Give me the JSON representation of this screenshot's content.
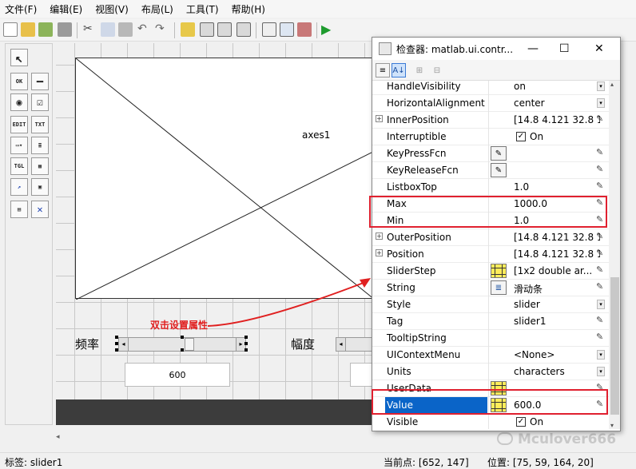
{
  "menu": [
    "文件(F)",
    "编辑(E)",
    "视图(V)",
    "布局(L)",
    "工具(T)",
    "帮助(H)"
  ],
  "canvas": {
    "axes_label": "axes1",
    "freq_label": "频率",
    "amp_label": "幅度",
    "edit_value": "600",
    "annotation": "双击设置属性"
  },
  "status": {
    "tag": "标签: slider1",
    "current_point": "当前点:  [652, 147]",
    "position": "位置: [75, 59, 164, 20]"
  },
  "inspector": {
    "title": "检查器:  matlab.ui.contr...",
    "rows": [
      {
        "name": "HandleVisibility",
        "value": "on",
        "kind": "dd"
      },
      {
        "name": "HorizontalAlignment",
        "value": "center",
        "kind": "dd"
      },
      {
        "name": "InnerPosition",
        "value": "[14.8 4.121 32.8 1....",
        "kind": "pen",
        "expand": true
      },
      {
        "name": "Interruptible",
        "value": "On",
        "kind": "check"
      },
      {
        "name": "KeyPressFcn",
        "value": "",
        "kind": "pen",
        "btn": "cb"
      },
      {
        "name": "KeyReleaseFcn",
        "value": "",
        "kind": "pen",
        "btn": "cb"
      },
      {
        "name": "ListboxTop",
        "value": "1.0",
        "kind": "pen"
      },
      {
        "name": "Max",
        "value": "1000.0",
        "kind": "pen"
      },
      {
        "name": "Min",
        "value": "1.0",
        "kind": "pen"
      },
      {
        "name": "OuterPosition",
        "value": "[14.8 4.121 32.8 1....",
        "kind": "pen",
        "expand": true
      },
      {
        "name": "Position",
        "value": "[14.8 4.121 32.8 1....",
        "kind": "pen",
        "expand": true
      },
      {
        "name": "SliderStep",
        "value": "[1x2  double ar...",
        "kind": "pen",
        "btn": "grid"
      },
      {
        "name": "String",
        "value": "滑动条",
        "kind": "pen",
        "btn": "list"
      },
      {
        "name": "Style",
        "value": "slider",
        "kind": "dd"
      },
      {
        "name": "Tag",
        "value": "slider1",
        "kind": "pen"
      },
      {
        "name": "TooltipString",
        "value": "",
        "kind": "pen"
      },
      {
        "name": "UIContextMenu",
        "value": "<None>",
        "kind": "dd"
      },
      {
        "name": "Units",
        "value": "characters",
        "kind": "dd"
      },
      {
        "name": "UserData",
        "value": "",
        "kind": "pen",
        "btn": "grid"
      },
      {
        "name": "Value",
        "value": "600.0",
        "kind": "pen",
        "btn": "grid",
        "selected": true
      },
      {
        "name": "Visible",
        "value": "On",
        "kind": "check"
      }
    ]
  },
  "watermark": "Mculover666"
}
